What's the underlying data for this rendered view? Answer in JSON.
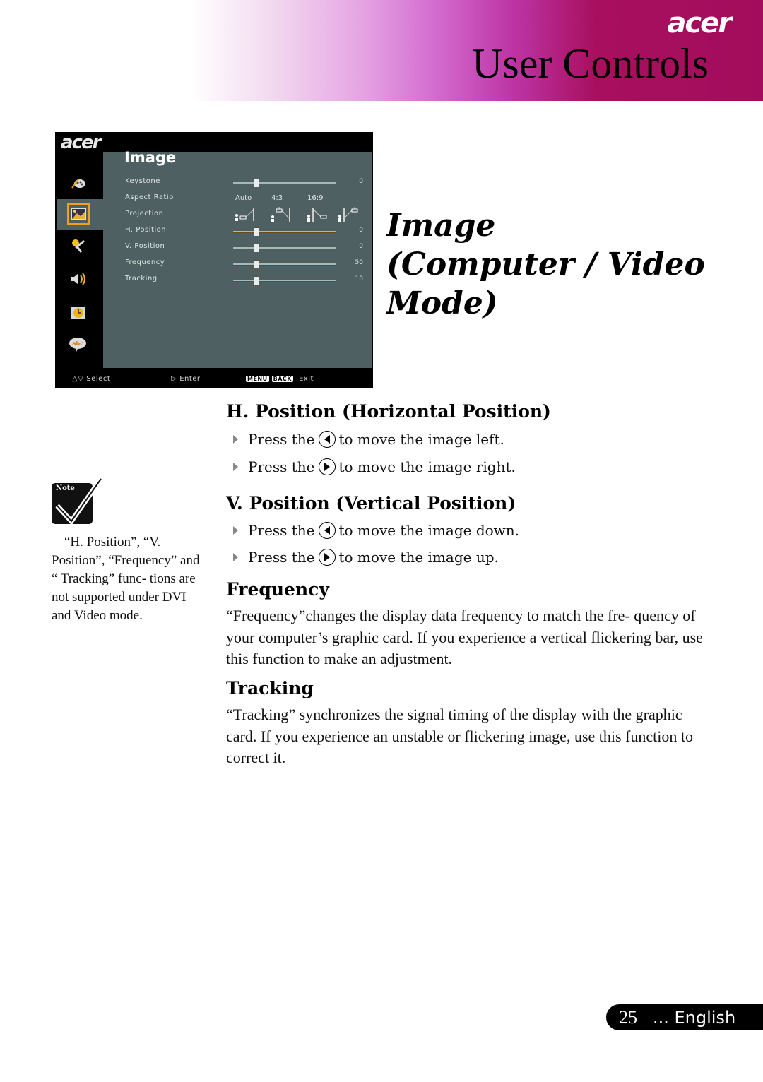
{
  "header": {
    "brand": "acer",
    "title": "User Controls",
    "gradient_colors": [
      "#ffffff",
      "#e6a6e4",
      "#bd35a6",
      "#a30c5c"
    ]
  },
  "osd": {
    "brand": "acer",
    "menu_title": "Image",
    "side_icons": [
      "palette-icon",
      "image-icon",
      "settings-wrench-icon",
      "speaker-icon",
      "clock-icon",
      "language-bubble-icon"
    ],
    "selected_side_icon": 1,
    "rows": [
      {
        "label": "Keystone",
        "type": "slider",
        "value": "0",
        "fraction": 0.2
      },
      {
        "label": "Aspect Ratio",
        "type": "options",
        "options": [
          "Auto",
          "4:3",
          "16:9"
        ]
      },
      {
        "label": "Projection",
        "type": "icons",
        "icons": [
          "front-desktop-projection-icon",
          "front-ceiling-projection-icon",
          "rear-desktop-projection-icon",
          "rear-ceiling-projection-icon"
        ]
      },
      {
        "label": "H. Position",
        "type": "slider",
        "value": "0",
        "fraction": 0.2
      },
      {
        "label": "V. Position",
        "type": "slider",
        "value": "0",
        "fraction": 0.2
      },
      {
        "label": "Frequency",
        "type": "slider",
        "value": "50",
        "fraction": 0.2
      },
      {
        "label": "Tracking",
        "type": "slider",
        "value": "10",
        "fraction": 0.2
      }
    ],
    "footer": {
      "select": "Select",
      "enter": "Enter",
      "menu_key": "MENU",
      "back_key": "BACK",
      "exit": "Exit"
    },
    "colors": {
      "panel": "#4f6062",
      "highlight": "#f0a020"
    }
  },
  "section_title": [
    "Image",
    "(Computer / Video",
    "Mode)"
  ],
  "h_position": {
    "heading": "H. Position (Horizontal Position)",
    "bullets": [
      {
        "prefix": "Press the",
        "button": "left-arrow",
        "suffix": "to move the image left."
      },
      {
        "prefix": "Press the",
        "button": "right-arrow",
        "suffix": "to move the image right."
      }
    ]
  },
  "v_position": {
    "heading": "V.  Position (Vertical Position)",
    "bullets": [
      {
        "prefix": "Press the",
        "button": "left-arrow",
        "suffix": "to move the image down."
      },
      {
        "prefix": "Press the",
        "button": "right-arrow",
        "suffix": "to move the image up."
      }
    ]
  },
  "frequency": {
    "heading": "Frequency",
    "body": "“Frequency”changes the display data frequency to match the fre- quency of your computer’s graphic card. If you experience a vertical flickering bar, use this function to make an adjustment."
  },
  "tracking": {
    "heading": "Tracking",
    "body": "“Tracking” synchronizes the signal timing of the display with the graphic card. If you experience an unstable or flickering image, use  this function to correct it."
  },
  "note": {
    "label": "Note",
    "text": "“H. Position”, “V. Position”, “Frequency” and “ Tracking” func- tions are not supported under DVI and Video mode."
  },
  "footer": {
    "page_number": "25",
    "language": "... English"
  }
}
